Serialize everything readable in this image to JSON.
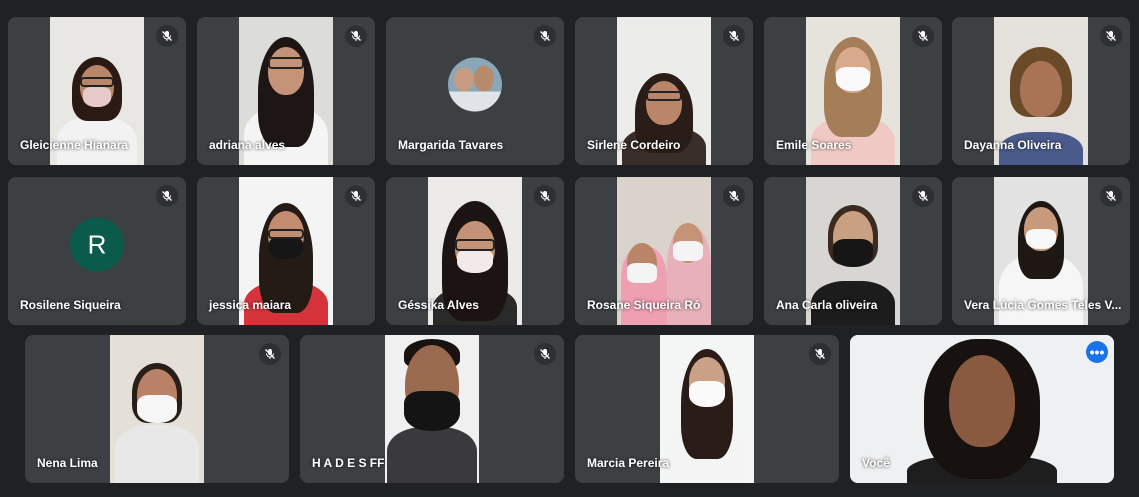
{
  "participants": [
    {
      "name": "Gleicienne Hianara",
      "muted": true
    },
    {
      "name": "adriana alves",
      "muted": true
    },
    {
      "name": "Margarida Tavares",
      "muted": true
    },
    {
      "name": "Sirlene Cordeiro",
      "muted": true
    },
    {
      "name": "Emile Soares",
      "muted": true
    },
    {
      "name": "Dayanna Oliveira",
      "muted": true
    },
    {
      "name": "Rosilene Siqueira",
      "muted": true,
      "initial": "R",
      "avatar_color": "#0b5b4c"
    },
    {
      "name": "jessica maiara",
      "muted": true
    },
    {
      "name": "Géssika Alves",
      "muted": true
    },
    {
      "name": "Rosane Siqueira Ró",
      "muted": true
    },
    {
      "name": "Ana Carla oliveira",
      "muted": true
    },
    {
      "name": "Vera Lúcia Gomes Teles V...",
      "muted": true
    },
    {
      "name": "Nena Lima",
      "muted": true
    },
    {
      "name": "H A D E S FF",
      "muted": true
    },
    {
      "name": "Marcia Pereira",
      "muted": true
    },
    {
      "name": "Você",
      "muted": false,
      "more_icon": "more-horiz-icon"
    }
  ],
  "theme": {
    "background": "#202124",
    "tile": "#3c4043",
    "active_outline": "#8ab4f8",
    "accent": "#1a73e8"
  }
}
